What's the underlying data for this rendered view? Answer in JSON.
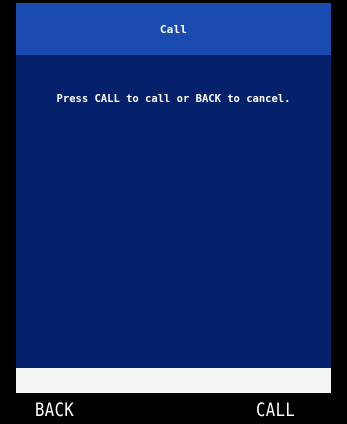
{
  "title_bar": {
    "title": "Call"
  },
  "content": {
    "message": "Press CALL to call or BACK to cancel."
  },
  "softkeys": {
    "left_label": "BACK",
    "right_label": "CALL"
  },
  "colors": {
    "title_bar_bg": "#1a4bb0",
    "content_bg": "#05216b",
    "input_strip_bg": "#f3f5f3",
    "softkey_bar_bg": "#000000",
    "text": "#ffffff"
  }
}
